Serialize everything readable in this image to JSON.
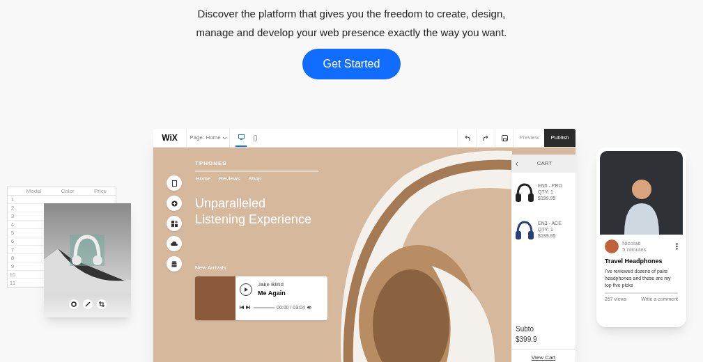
{
  "hero": {
    "lines": [
      "Discover the platform that gives you the freedom to create, design,",
      "manage and develop your web presence exactly the way you want."
    ],
    "cta": "Get Started"
  },
  "editor": {
    "logo": "WiX",
    "page_select": "Page: Home",
    "devices": [
      {
        "kind": "desktop",
        "selected": true
      },
      {
        "kind": "mobile",
        "selected": false
      }
    ],
    "preview": "Preview",
    "publish": "Publish",
    "site": {
      "brand": "TPHONES",
      "nav": [
        "Home",
        "Reviews",
        "Shop"
      ],
      "headline": [
        "Unparalleled",
        "Listening Experience"
      ],
      "section": "New Arrivals",
      "player": {
        "artist": "Jake Blind",
        "title": "Me Again",
        "time": "00:00 / 03:04",
        "level": 0
      }
    },
    "cart": {
      "title": "CART",
      "items": [
        {
          "name": "EN5 - PRO",
          "qty": "QTY: 1",
          "price": "$199.95",
          "color": "#222222"
        },
        {
          "name": "EN3 - ACE",
          "qty": "QTY: 1",
          "price": "$199.95",
          "color": "#2a3f7a"
        }
      ],
      "subtotal_label": "Subto",
      "subtotal": "$399.9",
      "view": "View Cart"
    }
  },
  "table": {
    "columns": [
      "Model",
      "Color",
      "Price"
    ],
    "rows": [
      "1",
      "2",
      "3",
      "4",
      "5",
      "6",
      "7",
      "8",
      "9",
      "10",
      "11"
    ]
  },
  "post": {
    "author": "Nicolas",
    "time": "5 minutes",
    "title": "Travel Headphones",
    "body": "I've reviewed dozens of pairs headphones and these are my top five picks",
    "views": "257 views",
    "comment": "Write a comment"
  }
}
